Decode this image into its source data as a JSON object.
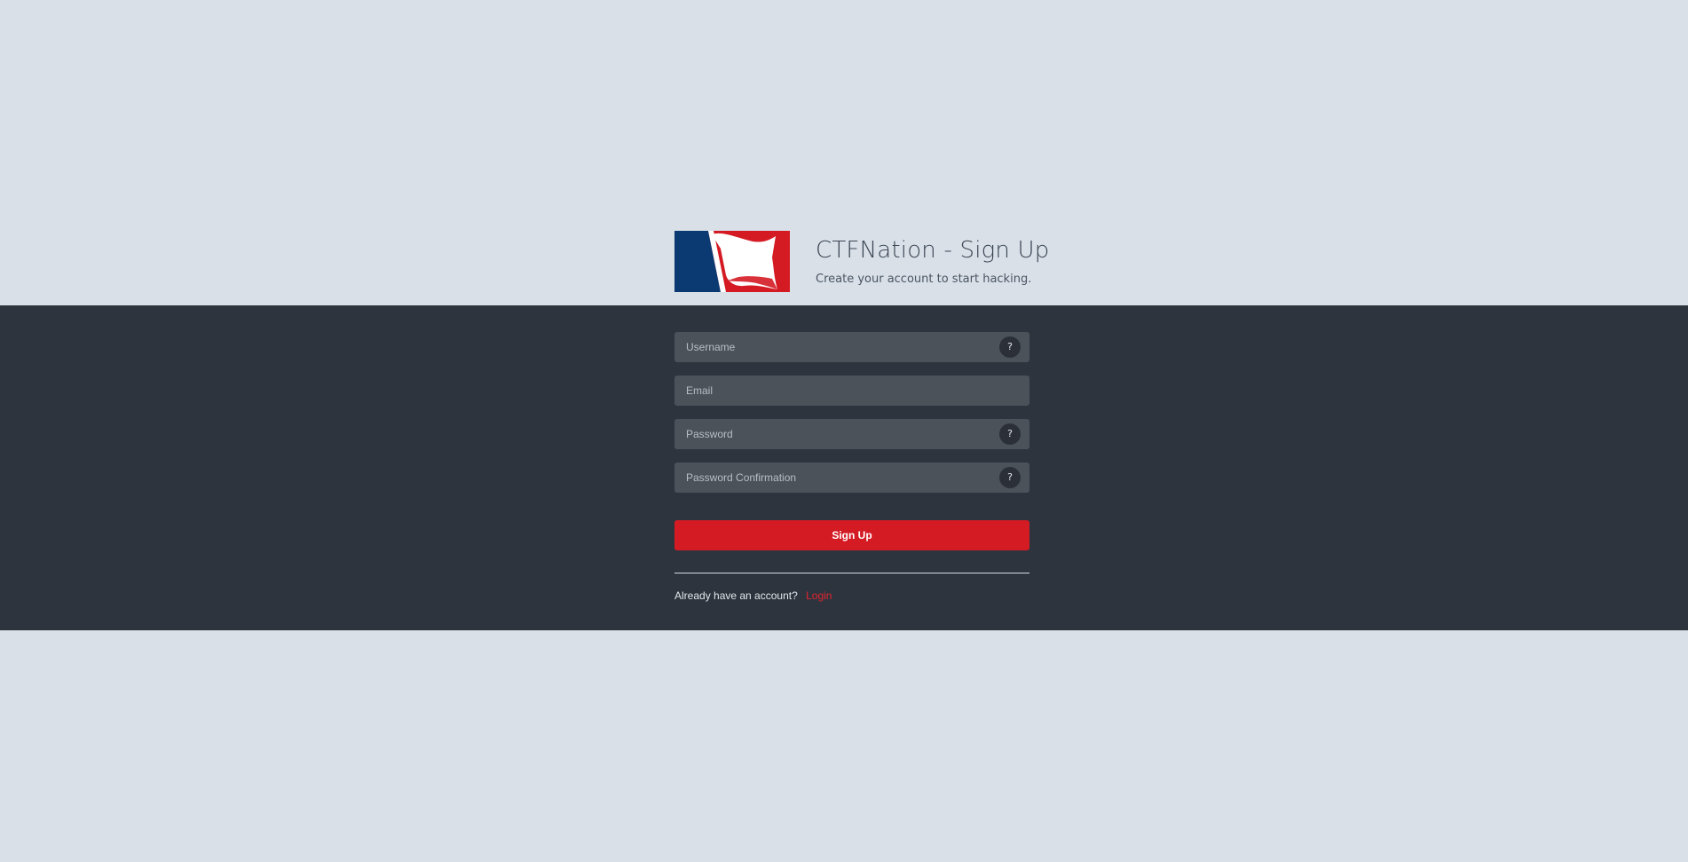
{
  "header": {
    "title": "CTFNation - Sign Up",
    "subtitle": "Create your account to start hacking."
  },
  "logo": {
    "icon": "flag-logo-icon",
    "colors": {
      "blue": "#0b3a73",
      "red": "#d41b24",
      "white": "#ffffff"
    }
  },
  "form": {
    "username": {
      "placeholder": "Username",
      "value": "",
      "help": "?"
    },
    "email": {
      "placeholder": "Email",
      "value": ""
    },
    "password": {
      "placeholder": "Password",
      "value": "",
      "help": "?"
    },
    "password_confirmation": {
      "placeholder": "Password Confirmation",
      "value": "",
      "help": "?"
    },
    "submit_label": "Sign Up"
  },
  "footer": {
    "prompt": "Already have an account?",
    "login_label": "Login"
  },
  "colors": {
    "background": "#d9e0e8",
    "band": "#2e343d",
    "field": "#4b525a",
    "accent": "#d41b24"
  }
}
